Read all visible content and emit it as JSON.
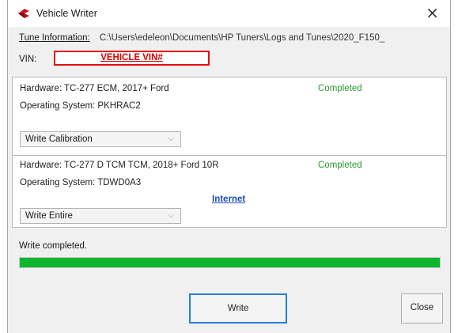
{
  "window": {
    "title": "Vehicle Writer",
    "close_glyph": "×"
  },
  "tune": {
    "label": "Tune Information:",
    "path": "C:\\Users\\edeleon\\Documents\\HP Tuners\\Logs and Tunes\\2020_F150_"
  },
  "vin": {
    "label": "VIN:",
    "value": "VEHICLE VIN#",
    "highlight_color": "#e01010"
  },
  "modules": [
    {
      "hardware": "Hardware:  TC-277 ECM, 2017+ Ford",
      "os": "Operating System:  PKHRAC2",
      "status": "Completed",
      "action": "Write Calibration"
    },
    {
      "hardware": "Hardware:  TC-277 D TCM TCM, 2018+ Ford 10R",
      "os": "Operating System:  TDWD0A3",
      "status": "Completed",
      "action": "Write Entire",
      "link": "Internet"
    }
  ],
  "status_message": "Write completed.",
  "progress": {
    "percent": 100,
    "color": "#0fb52c"
  },
  "buttons": {
    "write": "Write",
    "close": "Close"
  },
  "colors": {
    "status_green": "#2f9a2f",
    "link_blue": "#1a4fbf",
    "focus_blue": "#2a7bd5"
  }
}
